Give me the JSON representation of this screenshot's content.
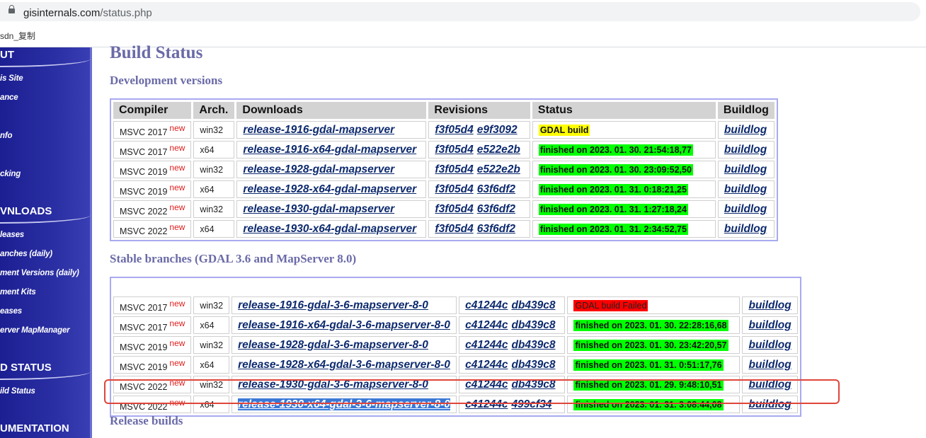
{
  "browser": {
    "url_host": "gisinternals.com",
    "url_path": "/status.php",
    "bookmark": "sdn_复制"
  },
  "sidebar": {
    "sections": [
      {
        "title": "UT",
        "items": [
          "is Site",
          "ance",
          "",
          "nfo",
          "",
          "cking"
        ]
      },
      {
        "title": "VNLOADS",
        "items": [
          "leases",
          "anches (daily)",
          "ment Versions (daily)",
          "ment Kits",
          "eases",
          "erver MapManager"
        ]
      },
      {
        "title": "D STATUS",
        "items": [
          "ild Status"
        ]
      },
      {
        "title": "UMENTATION",
        "items": []
      }
    ]
  },
  "page": {
    "title": "Build Status",
    "dev_heading": "Development versions",
    "stable_heading": "Stable branches (GDAL 3.6 and MapServer 8.0)",
    "release_heading": "Release builds",
    "new_badge": "new"
  },
  "dev_table": {
    "headers": [
      "Compiler",
      "Arch.",
      "Downloads",
      "Revisions",
      "Status",
      "Buildlog"
    ],
    "rows": [
      {
        "compiler": "MSVC 2017",
        "arch": "win32",
        "download": "release-1916-gdal-mapserver",
        "rev1": "f3f05d4",
        "rev2": "e9f3092",
        "status": "GDAL build",
        "status_color": "yellow",
        "buildlog": "buildlog"
      },
      {
        "compiler": "MSVC 2017",
        "arch": "x64",
        "download": "release-1916-x64-gdal-mapserver",
        "rev1": "f3f05d4",
        "rev2": "e522e2b",
        "status": "finished on 2023. 01. 30. 21:54:18,77",
        "status_color": "green",
        "buildlog": "buildlog"
      },
      {
        "compiler": "MSVC 2019",
        "arch": "win32",
        "download": "release-1928-gdal-mapserver",
        "rev1": "f3f05d4",
        "rev2": "e522e2b",
        "status": "finished on 2023. 01. 30. 23:09:52,50",
        "status_color": "green",
        "buildlog": "buildlog"
      },
      {
        "compiler": "MSVC 2019",
        "arch": "x64",
        "download": "release-1928-x64-gdal-mapserver",
        "rev1": "f3f05d4",
        "rev2": "63f6df2",
        "status": "finished on 2023. 01. 31. 0:18:21,25",
        "status_color": "green",
        "buildlog": "buildlog"
      },
      {
        "compiler": "MSVC 2022",
        "arch": "win32",
        "download": "release-1930-gdal-mapserver",
        "rev1": "f3f05d4",
        "rev2": "63f6df2",
        "status": "finished on 2023. 01. 31. 1:27:18,24",
        "status_color": "green",
        "buildlog": "buildlog"
      },
      {
        "compiler": "MSVC 2022",
        "arch": "x64",
        "download": "release-1930-x64-gdal-mapserver",
        "rev1": "f3f05d4",
        "rev2": "63f6df2",
        "status": "finished on 2023. 01. 31. 2:34:52,75",
        "status_color": "green",
        "buildlog": "buildlog"
      }
    ]
  },
  "stable_table": {
    "rows": [
      {
        "compiler": "MSVC 2017",
        "arch": "win32",
        "download": "release-1916-gdal-3-6-mapserver-8-0",
        "rev1": "c41244c",
        "rev2": "db439c8",
        "status": "GDAL build Failed",
        "status_color": "red",
        "buildlog": "buildlog"
      },
      {
        "compiler": "MSVC 2017",
        "arch": "x64",
        "download": "release-1916-x64-gdal-3-6-mapserver-8-0",
        "rev1": "c41244c",
        "rev2": "db439c8",
        "status": "finished on 2023. 01. 30. 22:28:16,68",
        "status_color": "green",
        "buildlog": "buildlog"
      },
      {
        "compiler": "MSVC 2019",
        "arch": "win32",
        "download": "release-1928-gdal-3-6-mapserver-8-0",
        "rev1": "c41244c",
        "rev2": "db439c8",
        "status": "finished on 2023. 01. 30. 23:42:20,57",
        "status_color": "green",
        "buildlog": "buildlog"
      },
      {
        "compiler": "MSVC 2019",
        "arch": "x64",
        "download": "release-1928-x64-gdal-3-6-mapserver-8-0",
        "rev1": "c41244c",
        "rev2": "db439c8",
        "status": "finished on 2023. 01. 31. 0:51:17,76",
        "status_color": "green",
        "buildlog": "buildlog"
      },
      {
        "compiler": "MSVC 2022",
        "arch": "win32",
        "download": "release-1930-gdal-3-6-mapserver-8-0",
        "rev1": "c41244c",
        "rev2": "db439c8",
        "status": "finished on 2023. 01. 29. 9:48:10,51",
        "status_color": "green",
        "buildlog": "buildlog"
      },
      {
        "compiler": "MSVC 2022",
        "arch": "x64",
        "download": "release-1930-x64-gdal-3-6-mapserver-8-0",
        "rev1": "c41244c",
        "rev2": "499cf34",
        "status": "finished on 2023. 01. 31. 3:08:44,08",
        "status_color": "green",
        "buildlog": "buildlog",
        "selected": true
      }
    ]
  },
  "colors": {
    "accent_heading": "#6a6aa8",
    "sidebar": "#1c1f92",
    "status_green": "#00ff00",
    "status_yellow": "#ffff00",
    "status_red": "#ff0000",
    "highlight": "#e0453a"
  }
}
